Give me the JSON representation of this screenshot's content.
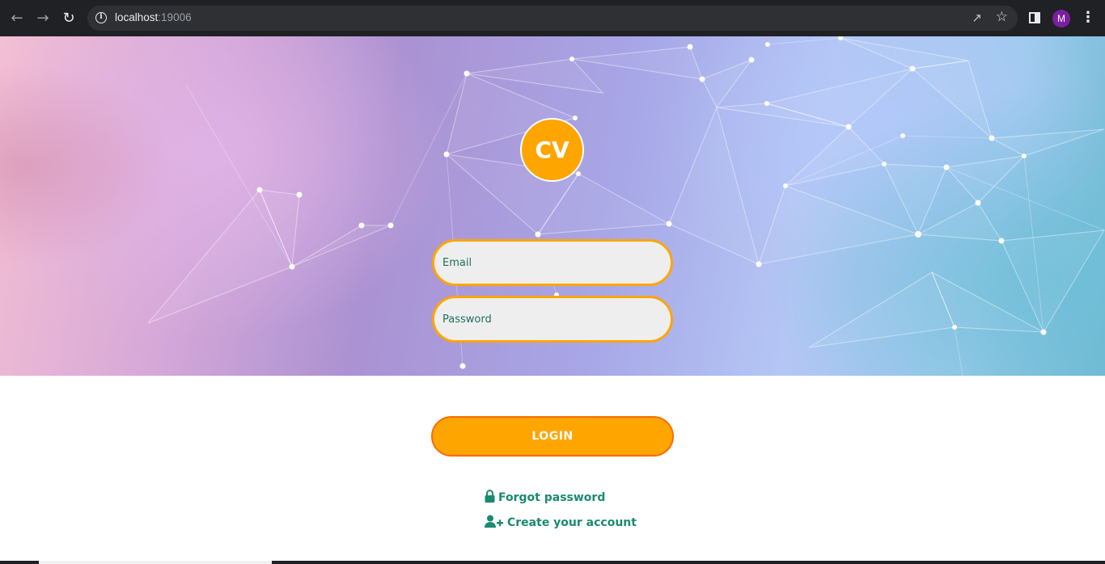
{
  "browser": {
    "url_host": "localhost",
    "url_port": ":19006",
    "profile_initial": "M"
  },
  "app": {
    "logo_text": "CV"
  },
  "form": {
    "email_placeholder": "Email",
    "password_placeholder": "Password",
    "login_label": "LOGIN"
  },
  "links": {
    "forgot_password": "Forgot password",
    "create_account": "Create your account"
  },
  "colors": {
    "accent": "#ffa500",
    "link": "#1b8a72",
    "login_border": "#ff6a00"
  }
}
